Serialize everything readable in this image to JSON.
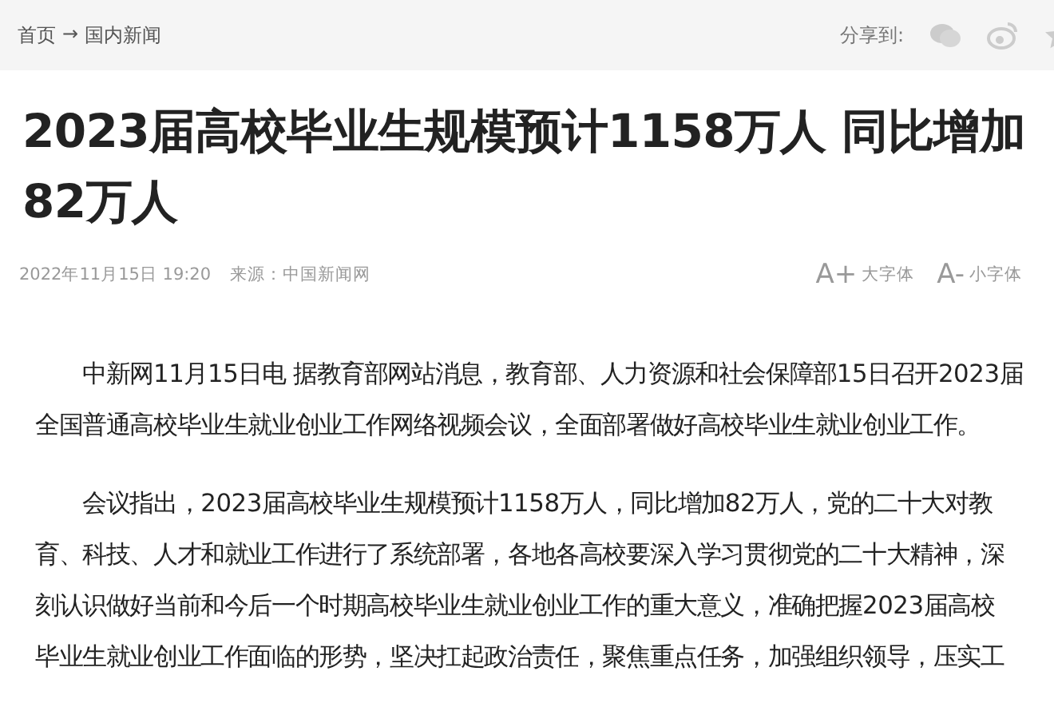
{
  "breadcrumb": {
    "home": "首页",
    "separator": "→",
    "current": "国内新闻"
  },
  "share": {
    "label": "分享到:"
  },
  "title": "2023届高校毕业生规模预计1158万人 同比增加82万人",
  "meta": {
    "time": "2022年11月15日 19:20",
    "source": "来源：中国新闻网",
    "font_larger": "大字体",
    "font_smaller": "小字体",
    "larger_glyph": "A+",
    "smaller_glyph": "A-"
  },
  "paragraphs": [
    {
      "lines": [
        "中新网11月15日电 据教育部网站消息，教育部、人力资源和社会保障部15日召开2023届",
        "全国普通高校毕业生就业创业工作网络视频会议，全面部署做好高校毕业生就业创业工作。"
      ]
    },
    {
      "lines": [
        "会议指出，2023届高校毕业生规模预计1158万人，同比增加82万人，党的二十大对教",
        "育、科技、人才和就业工作进行了系统部署，各地各高校要深入学习贯彻党的二十大精神，深",
        "刻认识做好当前和今后一个时期高校毕业生就业创业工作的重大意义，准确把握2023届高校",
        "毕业生就业创业工作面临的形势，坚决扛起政治责任，聚焦重点任务，加强组织领导，压实工"
      ]
    }
  ]
}
